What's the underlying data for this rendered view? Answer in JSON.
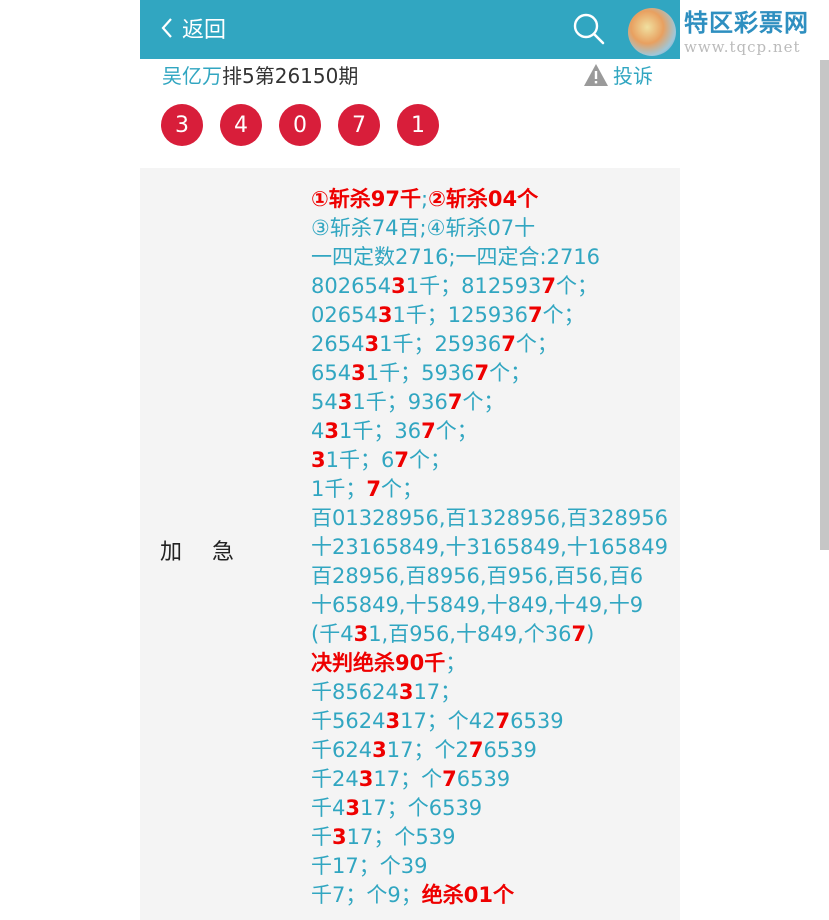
{
  "header": {
    "back_label": "返回"
  },
  "logo": {
    "text": "特区彩票网",
    "url": "www.tqcp.net"
  },
  "title": {
    "author": "吴亿万",
    "rest": "排5第26150期"
  },
  "complain_label": "投诉",
  "balls": [
    "3",
    "4",
    "0",
    "7",
    "1"
  ],
  "panel_label": "加急",
  "lines": [
    [
      {
        "t": "①斩杀97千",
        "r": true
      },
      {
        "t": ";",
        "r": false
      },
      {
        "t": "②斩杀04个",
        "r": true
      }
    ],
    [
      {
        "t": "③斩杀74百;④斩杀07十",
        "r": false
      }
    ],
    [
      {
        "t": "一四定数2716;一四定合:2716",
        "r": false
      }
    ],
    [
      {
        "t": "802654",
        "r": false
      },
      {
        "t": "3",
        "r": true
      },
      {
        "t": "1千；812593",
        "r": false
      },
      {
        "t": "7",
        "r": true
      },
      {
        "t": "个；",
        "r": false
      }
    ],
    [
      {
        "t": "02654",
        "r": false
      },
      {
        "t": "3",
        "r": true
      },
      {
        "t": "1千；125936",
        "r": false
      },
      {
        "t": "7",
        "r": true
      },
      {
        "t": "个；",
        "r": false
      }
    ],
    [
      {
        "t": "2654",
        "r": false
      },
      {
        "t": "3",
        "r": true
      },
      {
        "t": "1千；25936",
        "r": false
      },
      {
        "t": "7",
        "r": true
      },
      {
        "t": "个；",
        "r": false
      }
    ],
    [
      {
        "t": "654",
        "r": false
      },
      {
        "t": "3",
        "r": true
      },
      {
        "t": "1千；5936",
        "r": false
      },
      {
        "t": "7",
        "r": true
      },
      {
        "t": "个；",
        "r": false
      }
    ],
    [
      {
        "t": "54",
        "r": false
      },
      {
        "t": "3",
        "r": true
      },
      {
        "t": "1千；936",
        "r": false
      },
      {
        "t": "7",
        "r": true
      },
      {
        "t": "个；",
        "r": false
      }
    ],
    [
      {
        "t": "4",
        "r": false
      },
      {
        "t": "3",
        "r": true
      },
      {
        "t": "1千；36",
        "r": false
      },
      {
        "t": "7",
        "r": true
      },
      {
        "t": "个；",
        "r": false
      }
    ],
    [
      {
        "t": "3",
        "r": true
      },
      {
        "t": "1千；6",
        "r": false
      },
      {
        "t": "7",
        "r": true
      },
      {
        "t": "个；",
        "r": false
      }
    ],
    [
      {
        "t": "1千；",
        "r": false
      },
      {
        "t": "7",
        "r": true
      },
      {
        "t": "个；",
        "r": false
      }
    ],
    [
      {
        "t": "百01328956,百1328956,百328956",
        "r": false
      }
    ],
    [
      {
        "t": "十23165849,十3165849,十165849",
        "r": false
      }
    ],
    [
      {
        "t": "百28956,百8956,百956,百56,百6",
        "r": false
      }
    ],
    [
      {
        "t": "十65849,十5849,十849,十49,十9",
        "r": false
      }
    ],
    [
      {
        "t": "(千4",
        "r": false
      },
      {
        "t": "3",
        "r": true
      },
      {
        "t": "1,百956,十849,个36",
        "r": false
      },
      {
        "t": "7",
        "r": true
      },
      {
        "t": ")",
        "r": false
      }
    ],
    [
      {
        "t": "决判绝杀90千",
        "r": true
      },
      {
        "t": "；",
        "r": false
      }
    ],
    [
      {
        "t": "千85624",
        "r": false
      },
      {
        "t": "3",
        "r": true
      },
      {
        "t": "17；",
        "r": false
      }
    ],
    [
      {
        "t": "千5624",
        "r": false
      },
      {
        "t": "3",
        "r": true
      },
      {
        "t": "17；个42",
        "r": false
      },
      {
        "t": "7",
        "r": true
      },
      {
        "t": "6539",
        "r": false
      }
    ],
    [
      {
        "t": "千624",
        "r": false
      },
      {
        "t": "3",
        "r": true
      },
      {
        "t": "17；个2",
        "r": false
      },
      {
        "t": "7",
        "r": true
      },
      {
        "t": "6539",
        "r": false
      }
    ],
    [
      {
        "t": "千24",
        "r": false
      },
      {
        "t": "3",
        "r": true
      },
      {
        "t": "17；个",
        "r": false
      },
      {
        "t": "7",
        "r": true
      },
      {
        "t": "6539",
        "r": false
      }
    ],
    [
      {
        "t": "千4",
        "r": false
      },
      {
        "t": "3",
        "r": true
      },
      {
        "t": "17；个6539",
        "r": false
      }
    ],
    [
      {
        "t": "千",
        "r": false
      },
      {
        "t": "3",
        "r": true
      },
      {
        "t": "17；个539",
        "r": false
      }
    ],
    [
      {
        "t": "千17；个39",
        "r": false
      }
    ],
    [
      {
        "t": "千7；个9；",
        "r": false
      },
      {
        "t": "绝杀01个",
        "r": true
      }
    ]
  ]
}
